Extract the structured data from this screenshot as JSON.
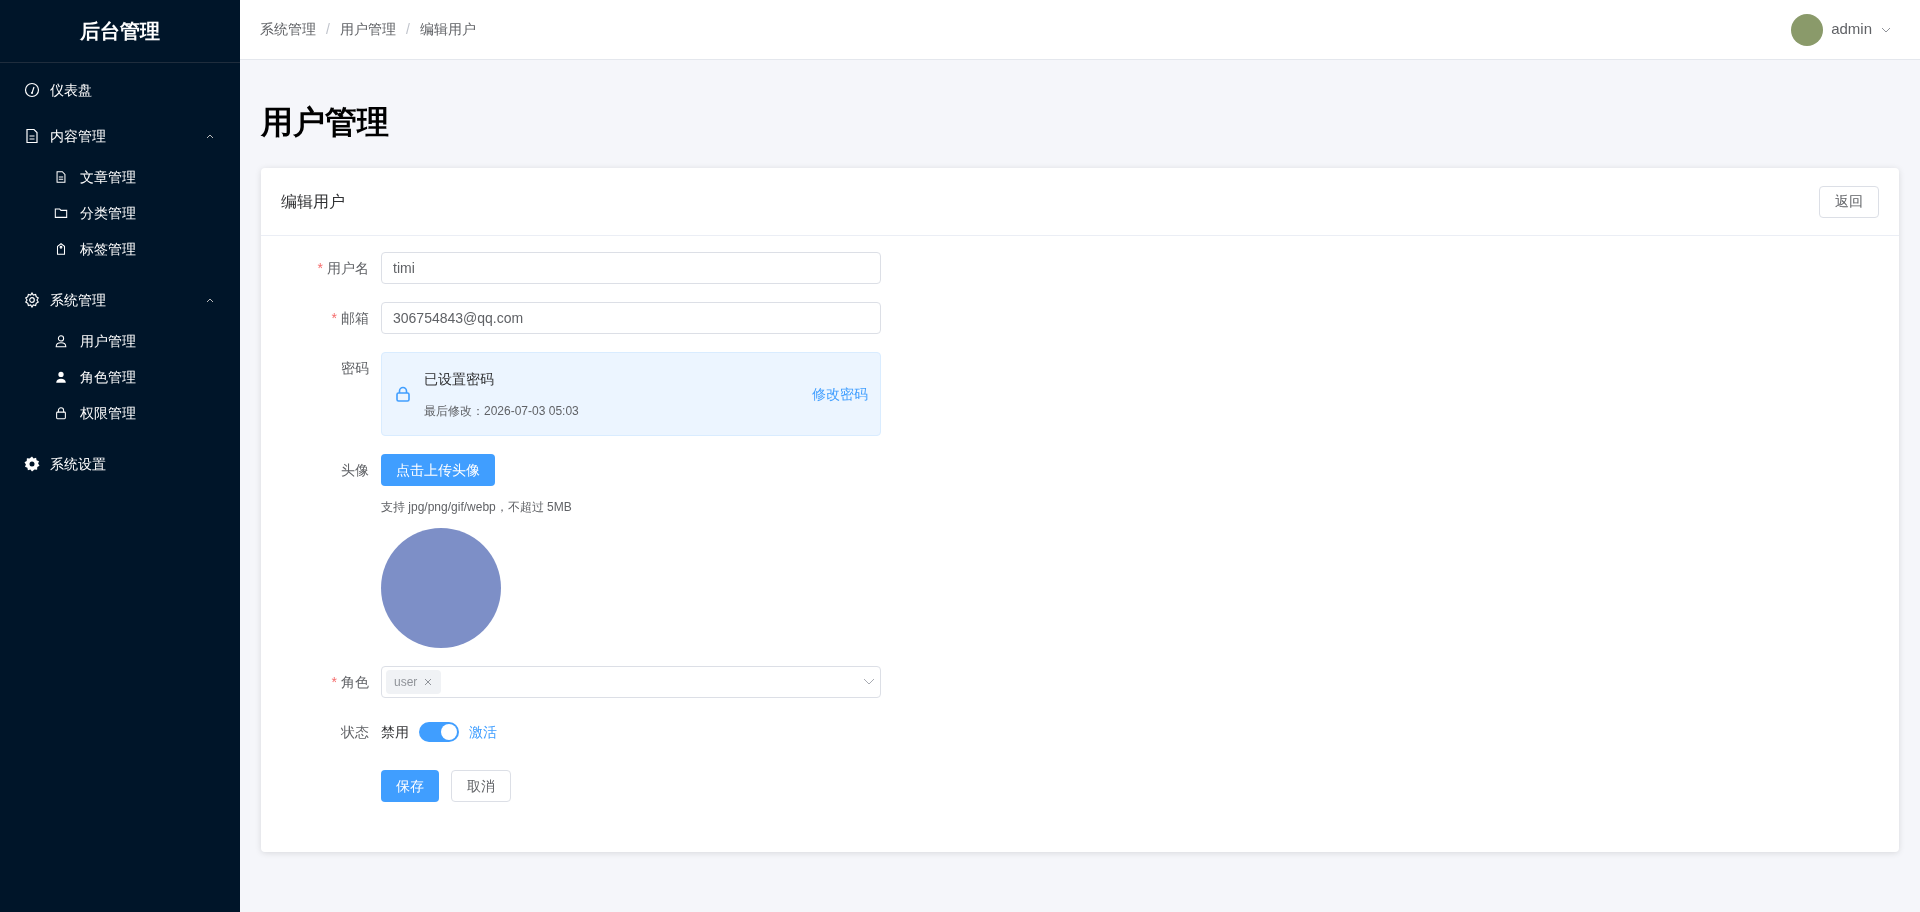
{
  "sidebar": {
    "title": "后台管理",
    "items": [
      {
        "kind": "item",
        "label": "仪表盘"
      },
      {
        "kind": "group",
        "label": "内容管理",
        "expanded": true,
        "children": [
          {
            "label": "文章管理"
          },
          {
            "label": "分类管理"
          },
          {
            "label": "标签管理"
          }
        ]
      },
      {
        "kind": "group",
        "label": "系统管理",
        "expanded": true,
        "children": [
          {
            "label": "用户管理"
          },
          {
            "label": "角色管理"
          },
          {
            "label": "权限管理"
          }
        ]
      },
      {
        "kind": "item",
        "label": "系统设置"
      }
    ]
  },
  "header": {
    "breadcrumb": [
      "系统管理",
      "用户管理",
      "编辑用户"
    ],
    "separator": "/",
    "user": {
      "name": "admin"
    }
  },
  "page_title": "用户管理",
  "card": {
    "title": "编辑用户",
    "back_button": "返回"
  },
  "form": {
    "required_mark": "*",
    "fields": [
      {
        "kind": "input",
        "label": "用户名",
        "required": true,
        "value": "timi"
      },
      {
        "kind": "input",
        "label": "邮箱",
        "required": true,
        "value": "306754843@qq.com"
      },
      {
        "kind": "password",
        "label": "密码",
        "required": false,
        "status": "已设置密码",
        "updated": "最后修改：2026-07-03 05:03",
        "link": "修改密码"
      },
      {
        "kind": "upload",
        "label": "头像",
        "required": false,
        "button": "点击上传头像",
        "hint": "支持 jpg/png/gif/webp，不超过 5MB"
      },
      {
        "kind": "tags",
        "label": "角色",
        "required": true,
        "tags": [
          "user"
        ]
      },
      {
        "kind": "switch",
        "label": "状态",
        "required": false,
        "off_label": "禁用",
        "on_label": "激活",
        "on": true
      }
    ],
    "actions": {
      "primary": "保存",
      "secondary": "取消"
    }
  }
}
